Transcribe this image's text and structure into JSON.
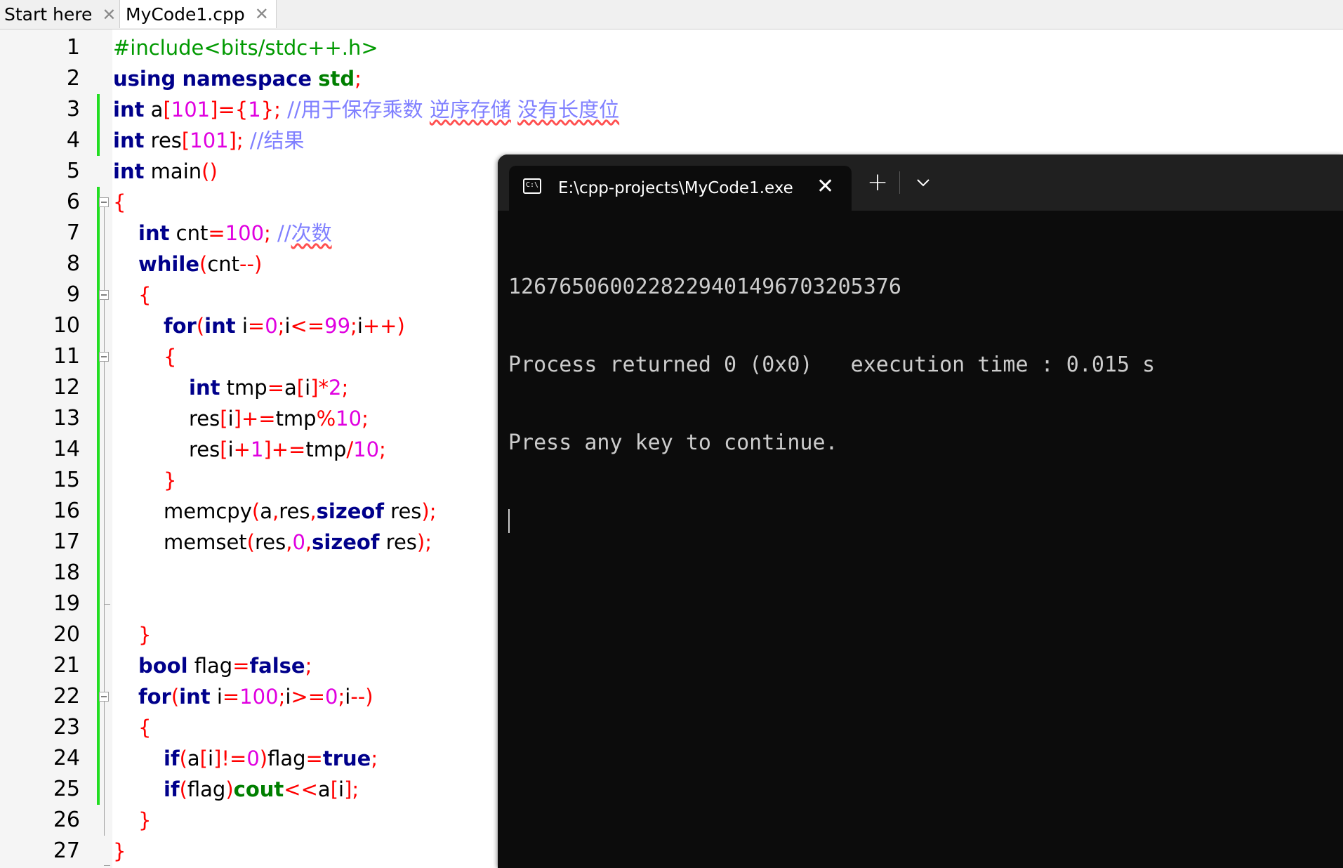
{
  "editor": {
    "tabs": [
      {
        "label": "Start here",
        "close": "✕"
      },
      {
        "label": "MyCode1.cpp",
        "close": "✕"
      }
    ],
    "line_numbers": [
      "1",
      "2",
      "3",
      "4",
      "5",
      "6",
      "7",
      "8",
      "9",
      "10",
      "11",
      "12",
      "13",
      "14",
      "15",
      "16",
      "17",
      "18",
      "19",
      "20",
      "21",
      "22",
      "23",
      "24",
      "25",
      "26",
      "27"
    ],
    "code": {
      "l1": {
        "pp": "#include<bits/stdc++.h>"
      },
      "l2": {
        "kw1": "using",
        "kw2": "namespace",
        "ty": "std",
        "op": ";"
      },
      "l3": {
        "kw": "int",
        "id": "a",
        "op1": "[",
        "n1": "101",
        "op2": "]={",
        "n2": "1",
        "op3": "};",
        "cm1": "//用于保存乘数 ",
        "cm2": "逆序存储",
        "cm3": "没有长度位"
      },
      "l4": {
        "kw": "int",
        "id": "res",
        "op1": "[",
        "n1": "101",
        "op2": "];",
        "cm": "//结果"
      },
      "l5": {
        "kw": "int",
        "id": "main",
        "op": "()"
      },
      "l6": {
        "op": "{"
      },
      "l7": {
        "kw": "int",
        "id": "cnt",
        "op1": "=",
        "n1": "100",
        "op2": ";",
        "cm1": "//",
        "cm2": "次数"
      },
      "l8": {
        "kw": "while",
        "op1": "(",
        "id": "cnt",
        "op2": "--)"
      },
      "l9": {
        "op": "{"
      },
      "l10": {
        "kw1": "for",
        "op1": "(",
        "kw2": "int",
        "id1": "i",
        "op2": "=",
        "n1": "0",
        "op3": ";",
        "id2": "i",
        "op4": "<=",
        "n2": "99",
        "op5": ";",
        "id3": "i",
        "op6": "++)"
      },
      "l11": {
        "op": "{"
      },
      "l12": {
        "kw": "int",
        "id1": "tmp",
        "op1": "=",
        "id2": "a",
        "op2": "[",
        "id3": "i",
        "op3": "]*",
        "n": "2",
        "op4": ";"
      },
      "l13": {
        "id1": "res",
        "op1": "[",
        "id2": "i",
        "op2": "]+=",
        "id3": "tmp",
        "op3": "%",
        "n": "10",
        "op4": ";"
      },
      "l14": {
        "id1": "res",
        "op1": "[",
        "id2": "i",
        "op2": "+",
        "n1": "1",
        "op3": "]+=",
        "id3": "tmp",
        "op4": "/",
        "n2": "10",
        "op5": ";"
      },
      "l15": {
        "op": "}"
      },
      "l16": {
        "id1": "memcpy",
        "op1": "(",
        "id2": "a",
        "op2": ",",
        "id3": "res",
        "op3": ",",
        "kw": "sizeof",
        "id4": "res",
        "op4": ");"
      },
      "l17": {
        "id1": "memset",
        "op1": "(",
        "id2": "res",
        "op2": ",",
        "n": "0",
        "op3": ",",
        "kw": "sizeof",
        "id3": "res",
        "op4": ");"
      },
      "l19": {
        "op": "}"
      },
      "l20": {
        "kw1": "bool",
        "id": "flag",
        "op1": "=",
        "kw2": "false",
        "op2": ";"
      },
      "l21": {
        "kw1": "for",
        "op1": "(",
        "kw2": "int",
        "id1": "i",
        "op2": "=",
        "n1": "100",
        "op3": ";",
        "id2": "i",
        "op4": ">=",
        "n2": "0",
        "op5": ";",
        "id3": "i",
        "op6": "--)"
      },
      "l22": {
        "op": "{"
      },
      "l23": {
        "kw1": "if",
        "op1": "(",
        "id1": "a",
        "op2": "[",
        "id2": "i",
        "op3": "]!=",
        "n": "0",
        "op4": ")",
        "id3": "flag",
        "op5": "=",
        "kw2": "true",
        "op6": ";"
      },
      "l24": {
        "kw": "if",
        "op1": "(",
        "id1": "flag",
        "op2": ")",
        "ty": "cout",
        "op3": "<<",
        "id2": "a",
        "op4": "[",
        "id3": "i",
        "op5": "];"
      },
      "l25": {
        "op": "}"
      },
      "l26": {
        "op": "}"
      }
    }
  },
  "terminal": {
    "title": "E:\\cpp-projects\\MyCode1.exe",
    "icon": "terminal-icon",
    "close": "✕",
    "new_tab": "+",
    "output": [
      "1267650600228229401496703205376",
      "Process returned 0 (0x0)   execution time : 0.015 s",
      "Press any key to continue."
    ]
  },
  "colors": {
    "keyword": "#00008b",
    "type": "#007f00",
    "preprocessor": "#009900",
    "operator": "#ff0000",
    "number": "#e000e0",
    "comment": "#8080ff",
    "change_marker": "#22dd22",
    "terminal_bg": "#0c0c0c",
    "terminal_titlebar": "#202020"
  }
}
